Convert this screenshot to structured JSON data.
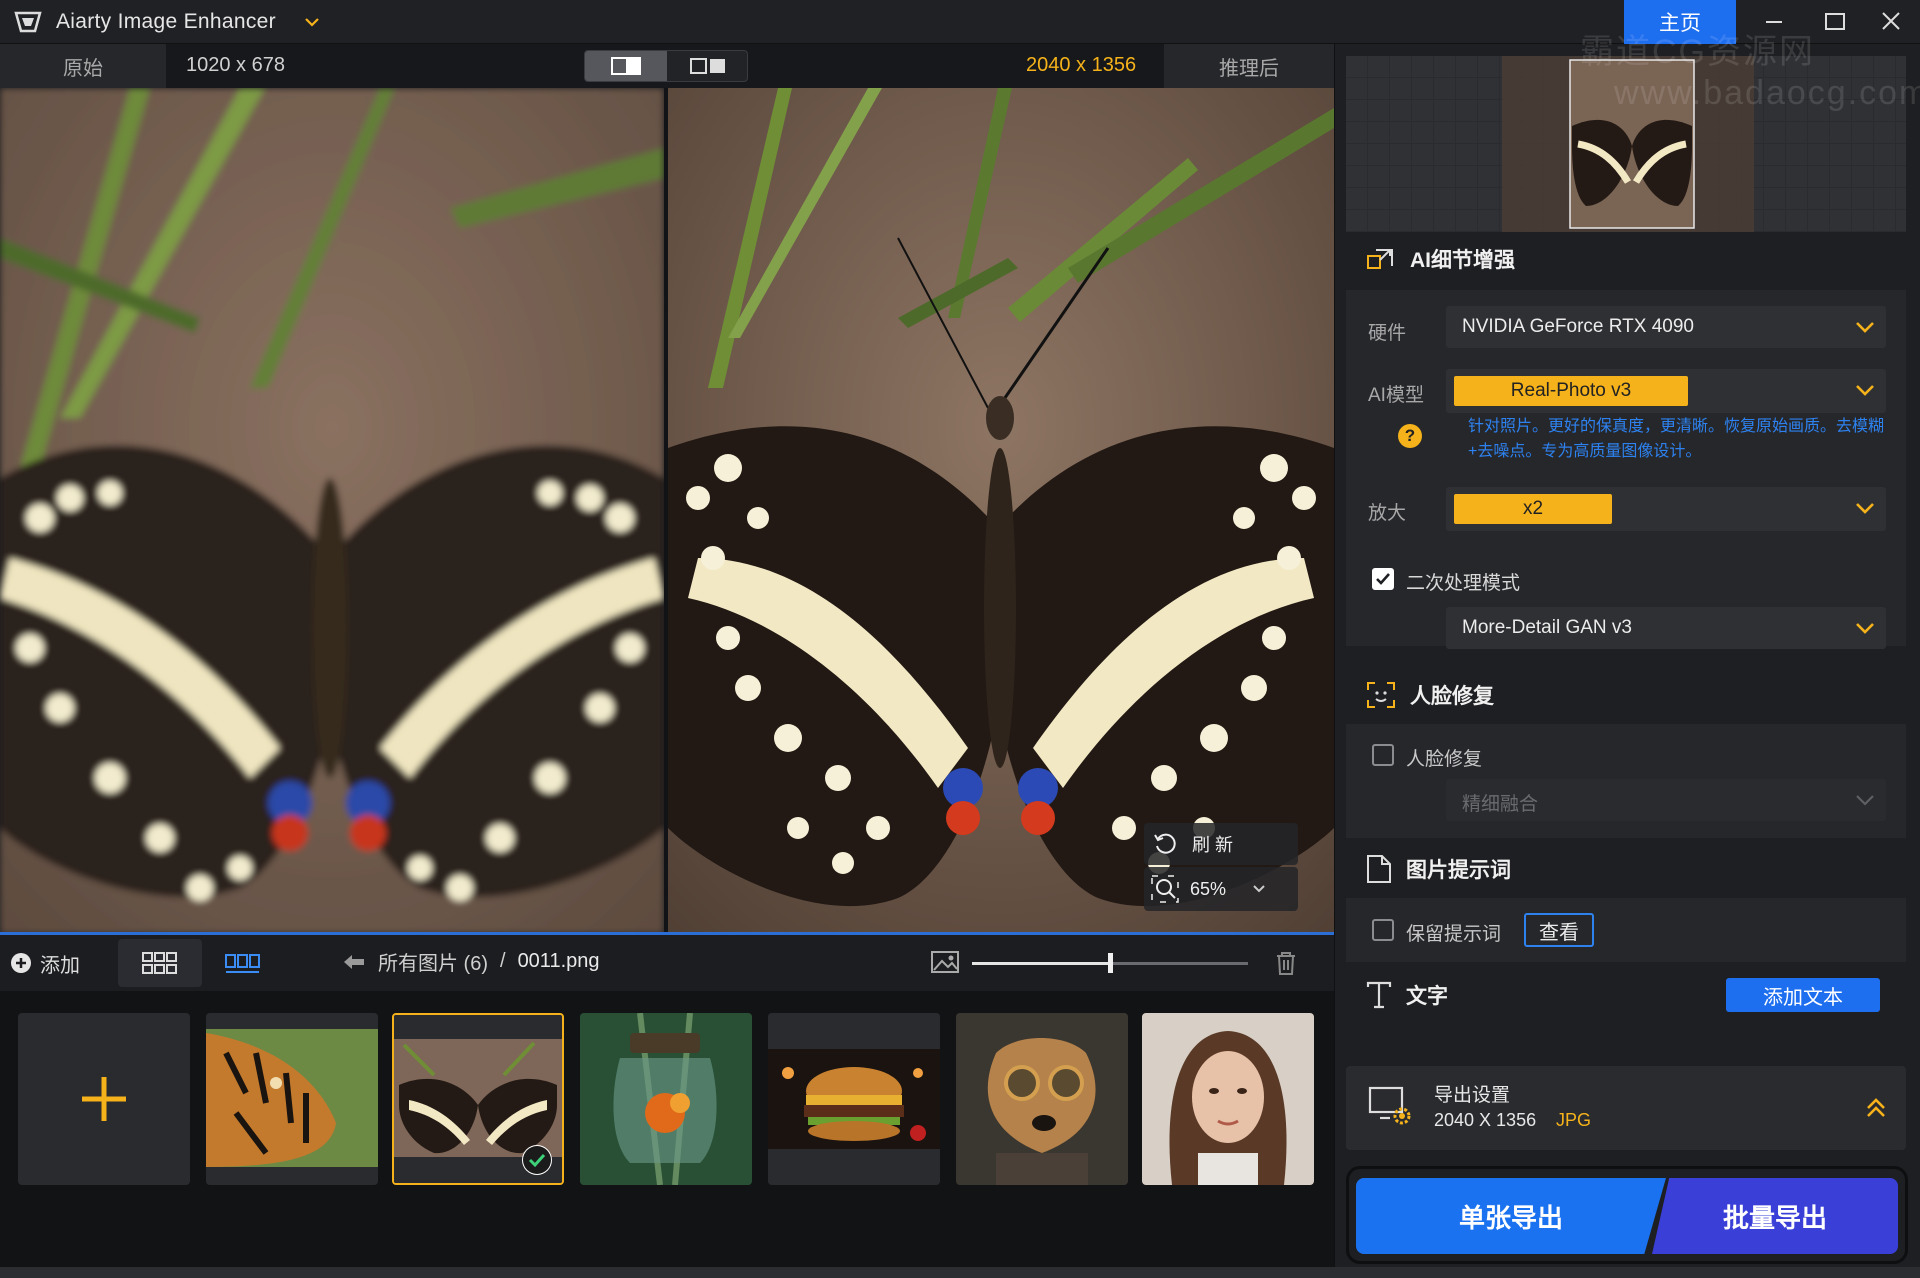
{
  "app": {
    "title": "Aiarty Image Enhancer",
    "home": "主页"
  },
  "compare": {
    "original_tab": "原始",
    "original_size": "1020 x 678",
    "output_size": "2040 x 1356",
    "after_tab": "推理后"
  },
  "overlay": {
    "refresh": "刷 新",
    "zoom": "65%"
  },
  "toolbar": {
    "add": "添加",
    "breadcrumb_all": "所有图片 (6)",
    "separator": "/",
    "file": "0011.png",
    "slider_fraction": 0.5
  },
  "thumbnails": [
    "tiger",
    "butterfly",
    "jar-forest",
    "burger",
    "dog-steampunk",
    "portrait"
  ],
  "panel": {
    "ai_section": "AI细节增强",
    "hardware_label": "硬件",
    "hardware_value": "NVIDIA GeForce RTX 4090",
    "model_label": "AI模型",
    "model_value": "Real-Photo  v3",
    "model_desc": "针对照片。更好的保真度，更清晰。恢复原始画质。去模糊+去噪点。专为高质量图像设计。",
    "scale_label": "放大",
    "scale_value": "x2",
    "second_pass_label": "二次处理模式",
    "second_pass_checked": true,
    "second_pass_value": "More-Detail GAN  v3",
    "face_section": "人脸修复",
    "face_label": "人脸修复",
    "face_mode": "精细融合",
    "prompt_section": "图片提示词",
    "prompt_keep": "保留提示词",
    "prompt_view": "查看",
    "text_section": "文字",
    "add_text": "添加文本",
    "export_title": "导出设置",
    "export_size": "2040 X 1356",
    "export_format": "JPG",
    "single_export": "单张导出",
    "batch_export": "批量导出"
  },
  "watermark": {
    "line1": "霸道CG资源网",
    "line2": "www.badaocg.com"
  },
  "colors": {
    "accent": "#f5b21a",
    "blue": "#1e6ef0",
    "bg": "#1b1c1f"
  }
}
